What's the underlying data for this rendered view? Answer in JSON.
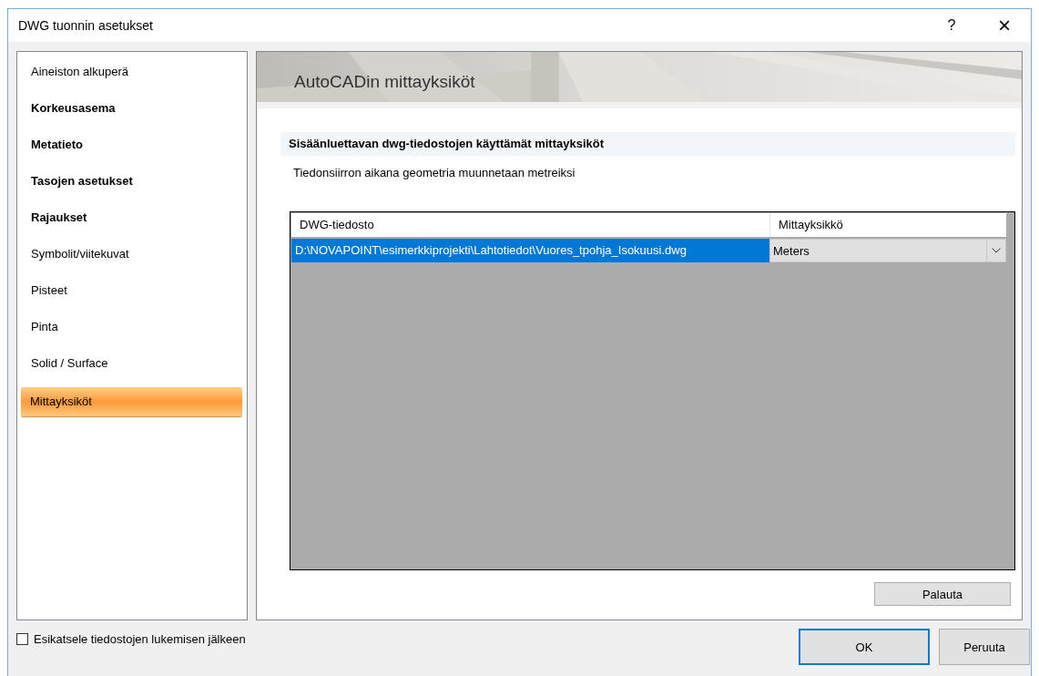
{
  "window": {
    "title": "DWG tuonnin asetukset",
    "help": "?",
    "close": "×"
  },
  "sidebar": {
    "items": [
      {
        "label": "Aineiston alkuperä",
        "emphasized": false,
        "selected": false
      },
      {
        "label": "Korkeusasema",
        "emphasized": true,
        "selected": false
      },
      {
        "label": "Metatieto",
        "emphasized": true,
        "selected": false
      },
      {
        "label": "Tasojen asetukset",
        "emphasized": true,
        "selected": false
      },
      {
        "label": "Rajaukset",
        "emphasized": true,
        "selected": false
      },
      {
        "label": "Symbolit/viitekuvat",
        "emphasized": false,
        "selected": false
      },
      {
        "label": "Pisteet",
        "emphasized": false,
        "selected": false
      },
      {
        "label": "Pinta",
        "emphasized": false,
        "selected": false
      },
      {
        "label": "Solid / Surface",
        "emphasized": false,
        "selected": false
      },
      {
        "label": "Mittayksiköt",
        "emphasized": false,
        "selected": true
      }
    ]
  },
  "panel": {
    "banner": {
      "kind": "picture",
      "title": "AutoCADin mittayksiköt"
    },
    "section_title": "Sisäänluettavan dwg-tiedostojen käyttämät mittayksiköt",
    "description": "Tiedonsiirron aikana geometria muunnetaan metreiksi",
    "table": {
      "columns": [
        "DWG-tiedosto",
        "Mittayksikkö"
      ],
      "rows": [
        {
          "file": "D:\\NOVAPOINT\\esimerkkiprojekti\\Lahtotiedot\\Vuores_tpohja_Isokuusi.dwg",
          "unit": "Meters",
          "selected": true
        }
      ]
    },
    "reset_button": "Palauta"
  },
  "preview_checkbox": {
    "label": "Esikatsele tiedostojen lukemisen jälkeen",
    "checked": false
  },
  "buttons": [
    {
      "label": "OK",
      "default": true
    },
    {
      "label": "Peruuta",
      "default": false
    }
  ]
}
